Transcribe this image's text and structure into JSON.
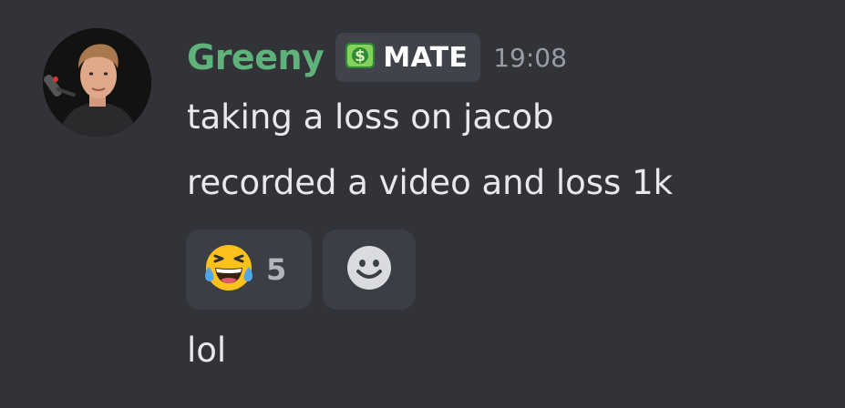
{
  "message": {
    "author": {
      "name": "Greeny",
      "name_color": "#5fb27a",
      "badge_label": "MATE",
      "badge_icon": "dollar-icon"
    },
    "timestamp": "19:08",
    "lines": [
      "taking a loss on jacob",
      "recorded a video and loss 1k"
    ],
    "reactions": [
      {
        "emoji": "joy-emoji",
        "count": "5"
      }
    ],
    "add_reaction_icon": "smiley-add-icon",
    "followup": "lol"
  }
}
